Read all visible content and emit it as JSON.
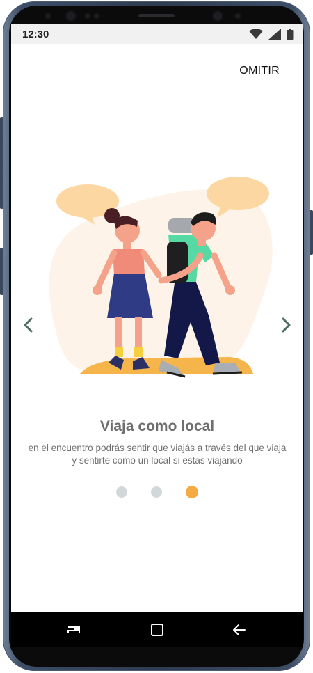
{
  "status_bar": {
    "time": "12:30",
    "icons": [
      "wifi-icon",
      "signal-icon",
      "battery-icon"
    ]
  },
  "header": {
    "skip_label": "OMITIR"
  },
  "carousel": {
    "prev_icon": "chevron-left-icon",
    "next_icon": "chevron-right-icon",
    "title": "Viaja como local",
    "description": "en el encuentro podrás sentir que viajás a través del que viaja y sentirte como un local si estas viajando",
    "page_count": 3,
    "active_page": 3
  },
  "system_nav": {
    "buttons": [
      "recents-icon",
      "home-icon",
      "back-icon"
    ]
  },
  "colors": {
    "accent": "#f5ab44",
    "dot_inactive": "#d2d7d9",
    "text_muted": "#6e6e6e",
    "arrow": "#4f6b66"
  }
}
